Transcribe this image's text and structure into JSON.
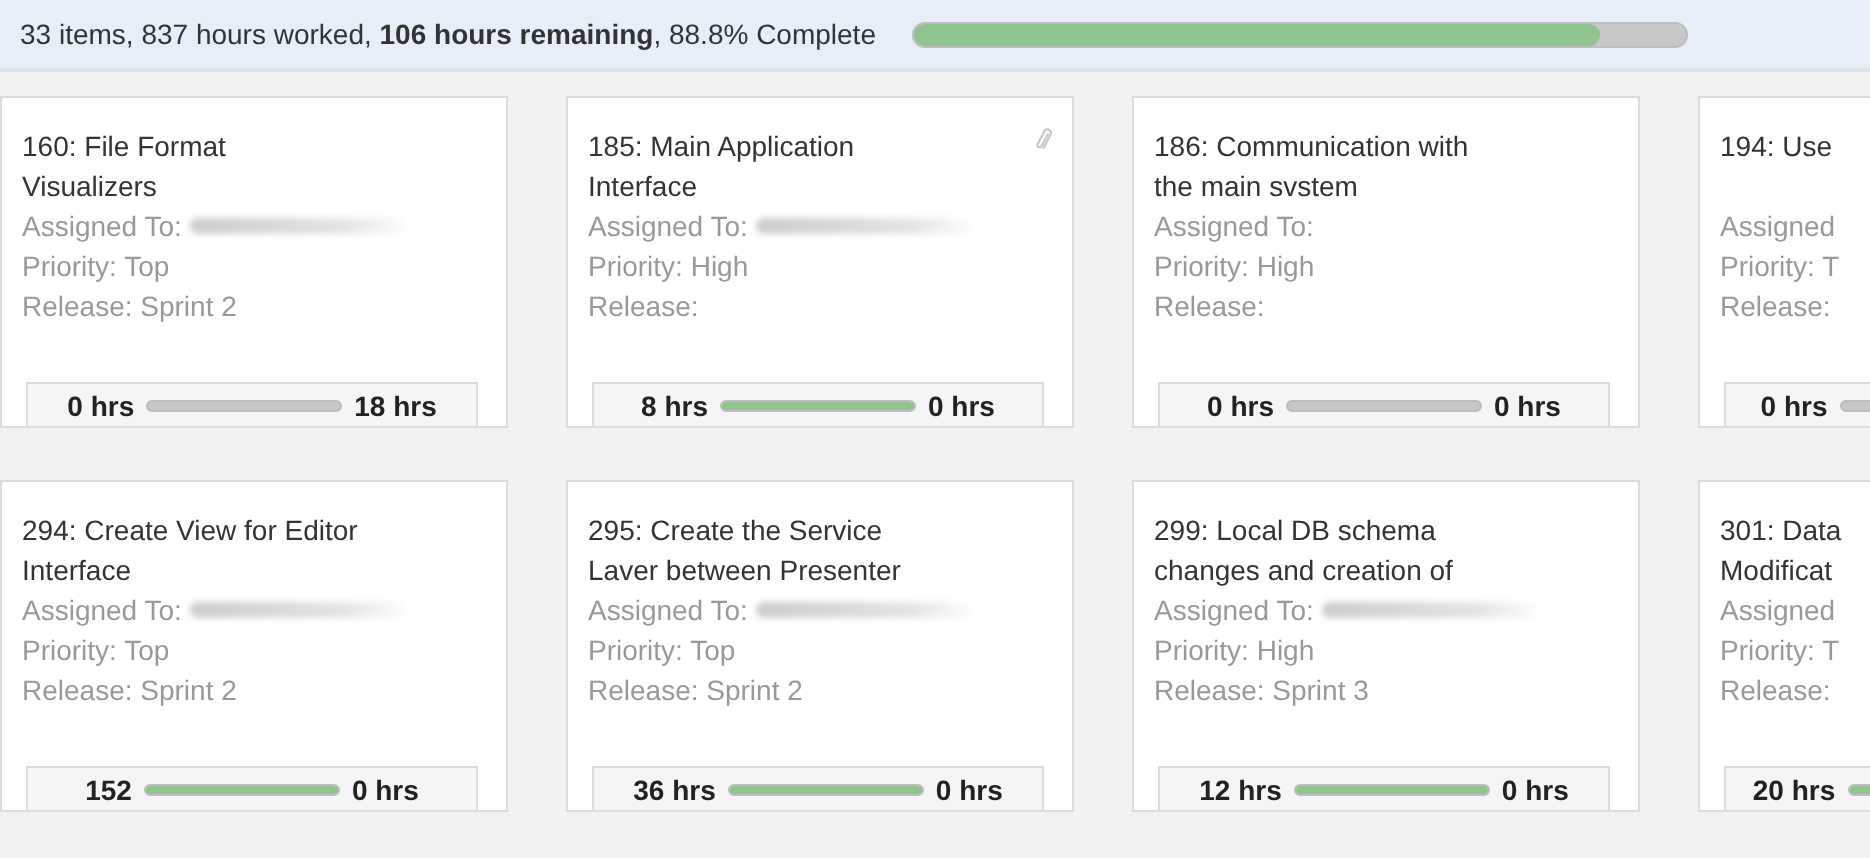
{
  "summary": {
    "text": "33 items, 837 hours worked, **106 hours remaining**, 88.8% Complete",
    "level": 0.888
  },
  "cards": [
    {
      "title": "160: File Format\nVisualizers",
      "assigned": "Assigned To:",
      "assignee_hidden": true,
      "priority": "Priority: Top",
      "release": "Release: Sprint 2",
      "attachment": false,
      "worked": "0 hrs",
      "remaining": "18 hrs"
    },
    {
      "title": "185: Main Application\nInterface",
      "assigned": "Assigned To:",
      "assignee_hidden": true,
      "priority": "Priority: High",
      "release": "Release:",
      "attachment": true,
      "worked": "8 hrs",
      "level": 1,
      "remaining": "0 hrs"
    },
    {
      "title": "186: Communication with\nthe main svstem",
      "assigned": "Assigned To:",
      "assignee_hidden": false,
      "priority": "Priority: High",
      "release": "Release:",
      "attachment": false,
      "worked": "0 hrs",
      "remaining": "0 hrs"
    },
    {
      "title": "194: Use",
      "assigned": "Assigned",
      "assignee_hidden": false,
      "priority": "Priority: T",
      "release": "Release:",
      "attachment": false,
      "worked": "0 hrs"
    },
    {
      "title": "294: Create View for Editor\nInterface",
      "assigned": "Assigned To:",
      "assignee_hidden": true,
      "priority": "Priority: Top",
      "release": "Release: Sprint 2",
      "attachment": false,
      "worked": "152",
      "level": 1,
      "remaining": "0 hrs"
    },
    {
      "title": "295: Create the Service\nLaver between Presenter",
      "assigned": "Assigned To:",
      "assignee_hidden": true,
      "priority": "Priority: Top",
      "release": "Release: Sprint 2",
      "attachment": false,
      "worked": "36 hrs",
      "level": 1,
      "remaining": "0 hrs"
    },
    {
      "title": "299: Local DB schema\nchanges and creation of",
      "assigned": "Assigned To:",
      "assignee_hidden": true,
      "priority": "Priority: High",
      "release": "Release: Sprint 3",
      "attachment": false,
      "worked": "12 hrs",
      "level": 1,
      "remaining": "0 hrs"
    },
    {
      "title": "301: Data\nModificat",
      "assigned": "Assigned",
      "assignee_hidden": false,
      "priority": "Priority: T",
      "release": "Release:",
      "attachment": false,
      "worked": "20 hrs",
      "level": 1
    }
  ]
}
